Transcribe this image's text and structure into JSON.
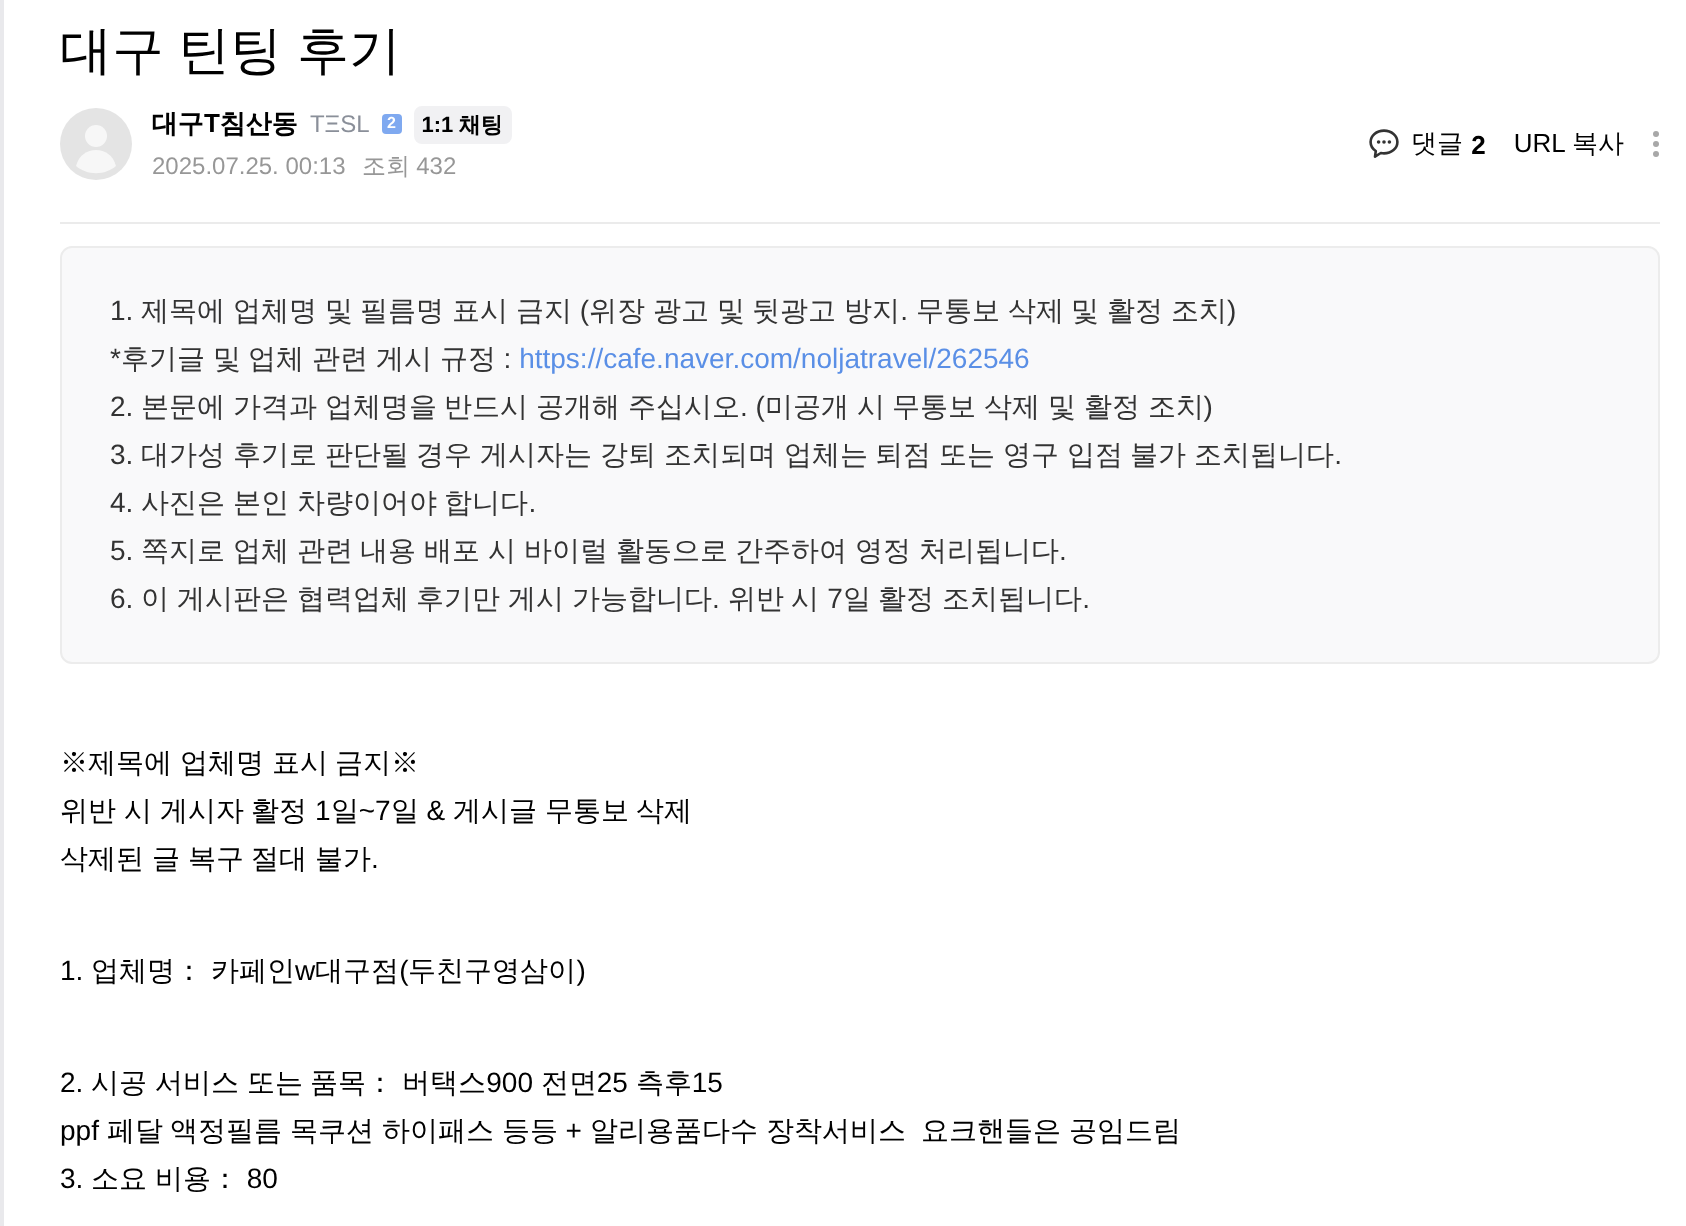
{
  "title": "대구 틴팅 후기",
  "author": {
    "name": "대구T침산동",
    "rank": "TΞSL",
    "level_badge": "2",
    "chat_button": "1:1 채팅",
    "date": "2025.07.25. 00:13",
    "views": "조회 432"
  },
  "actions": {
    "comments_label": "댓글",
    "comments_count": "2",
    "copy_url": "URL 복사"
  },
  "notice": {
    "lines": [
      {
        "text": "1. 제목에 업체명 및 필름명 표시 금지 (위장 광고 및 뒷광고 방지. 무통보 삭제 및 활정 조치)"
      },
      {
        "text": "*후기글 및 업체 관련 게시 규정 : ",
        "link": "https://cafe.naver.com/noljatravel/262546"
      },
      {
        "text": "2. 본문에 가격과 업체명을 반드시 공개해 주십시오. (미공개 시 무통보 삭제 및 활정 조치)"
      },
      {
        "text": "3. 대가성 후기로 판단될 경우 게시자는 강퇴 조치되며 업체는 퇴점 또는 영구 입점 불가 조치됩니다."
      },
      {
        "text": "4. 사진은 본인 차량이어야 합니다."
      },
      {
        "text": "5. 쪽지로 업체 관련 내용 배포 시 바이럴 활동으로 간주하여 영정 처리됩니다."
      },
      {
        "text": "6. 이 게시판은 협력업체 후기만 게시 가능합니다. 위반 시 7일 활정 조치됩니다."
      }
    ]
  },
  "body": {
    "paragraphs": [
      {
        "lines": [
          "※제목에 업체명 표시 금지※",
          "위반 시 게시자 활정 1일~7일 & 게시글 무통보 삭제",
          "삭제된 글 복구 절대 불가."
        ]
      },
      {
        "lines": [
          "1. 업체명： 카페인w대구점(두친구영삼이)"
        ]
      },
      {
        "lines": [
          "2. 시공 서비스 또는 품목： 버택스900 전면25 측후15",
          "ppf 페달 액정필름 목쿠션 하이패스 등등 + 알리용품다수 장착서비스  요크핸들은 공임드림",
          "3. 소요 비용： 80"
        ]
      }
    ]
  }
}
